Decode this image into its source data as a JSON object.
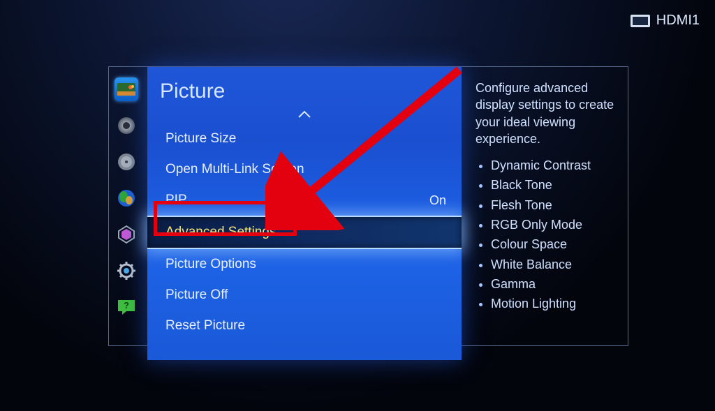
{
  "input_source": "HDMI1",
  "panel": {
    "title": "Picture",
    "items": [
      {
        "label": "Picture Size"
      },
      {
        "label": "Open Multi-Link Screen"
      },
      {
        "label": "PIP",
        "value": "On"
      },
      {
        "label": "Advanced Settings",
        "selected": true
      },
      {
        "label": "Picture Options"
      },
      {
        "label": "Picture Off"
      },
      {
        "label": "Reset Picture"
      }
    ]
  },
  "rail_icons": [
    {
      "name": "picture-icon"
    },
    {
      "name": "sound-icon"
    },
    {
      "name": "broadcast-icon"
    },
    {
      "name": "network-icon"
    },
    {
      "name": "smarthub-icon"
    },
    {
      "name": "system-icon"
    },
    {
      "name": "support-icon"
    }
  ],
  "description": {
    "text": "Configure advanced display settings to create your ideal viewing experience.",
    "bullets": [
      "Dynamic Contrast",
      "Black Tone",
      "Flesh Tone",
      "RGB Only Mode",
      "Colour Space",
      "White Balance",
      "Gamma",
      "Motion Lighting"
    ]
  },
  "annotation": {
    "highlight_target": "Advanced Settings"
  }
}
